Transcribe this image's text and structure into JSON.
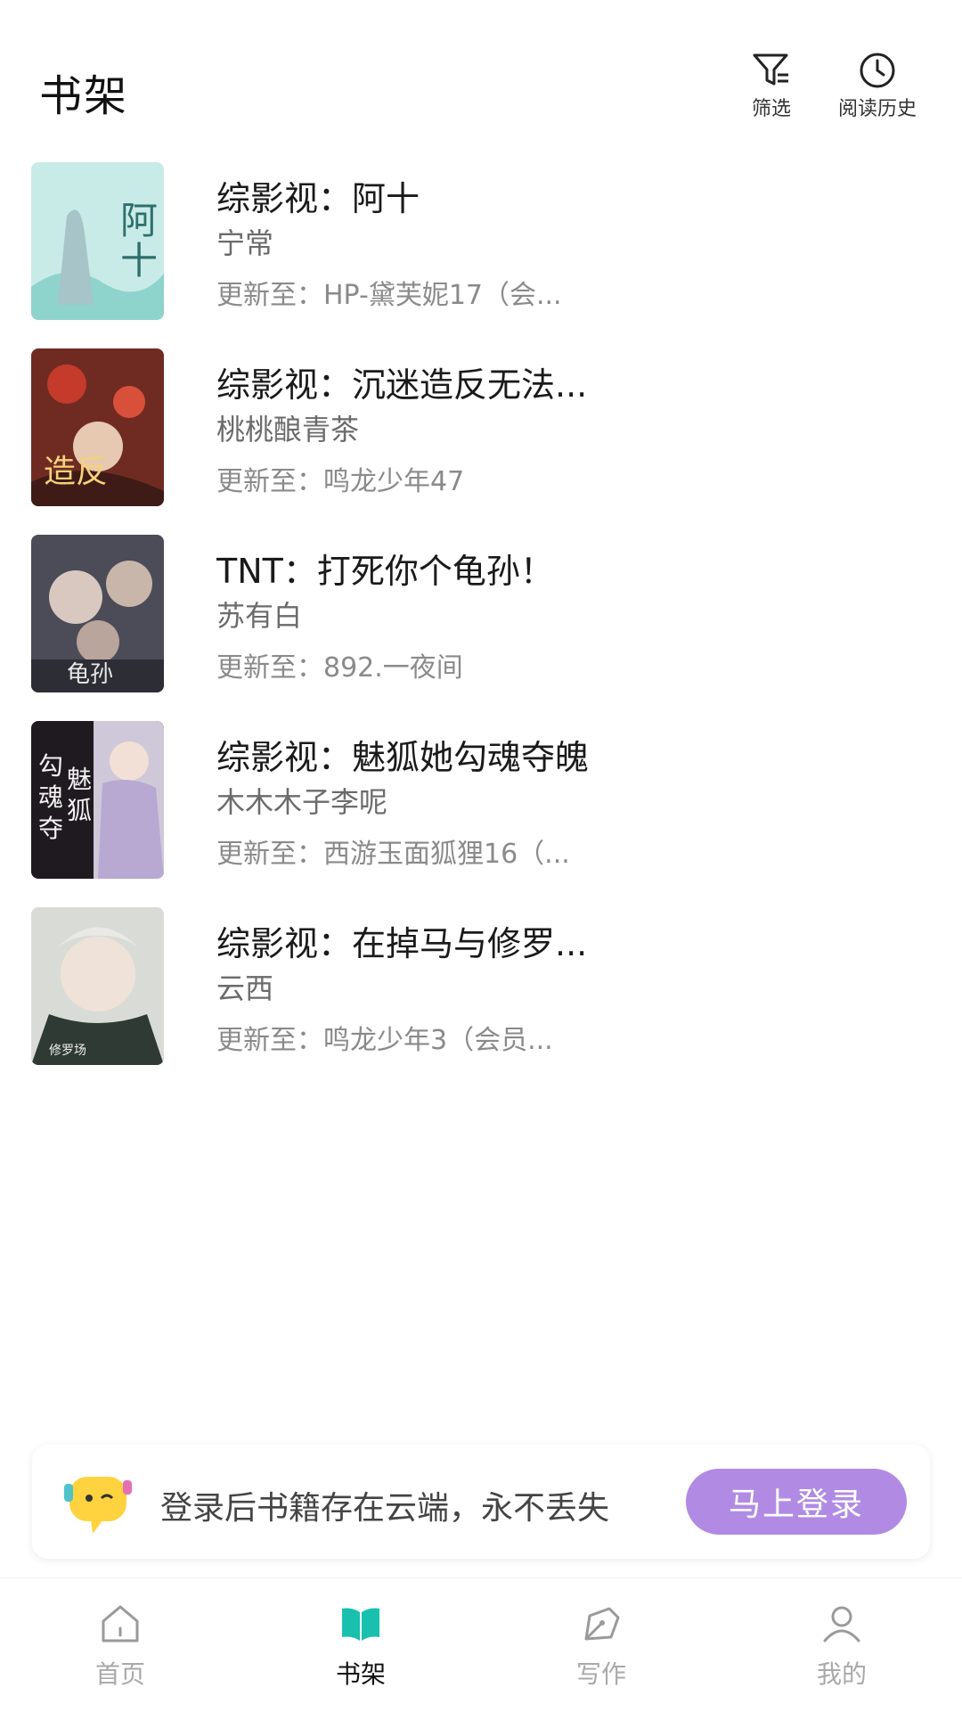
{
  "header": {
    "title": "书架",
    "filter_label": "筛选",
    "history_label": "阅读历史"
  },
  "books": [
    {
      "title": "综影视：阿十",
      "author": "宁常",
      "update": "更新至：HP-黛芙妮17（会..."
    },
    {
      "title": "综影视：沉迷造反无法...",
      "author": "桃桃酿青茶",
      "update": "更新至：鸣龙少年47"
    },
    {
      "title": "TNT：打死你个龟孙！",
      "author": "苏有白",
      "update": "更新至：892.一夜间"
    },
    {
      "title": "综影视：魅狐她勾魂夺魄",
      "author": "木木木子李呢",
      "update": "更新至：西游玉面狐狸16（..."
    },
    {
      "title": "综影视：在掉马与修罗...",
      "author": "云西",
      "update": "更新至：鸣龙少年3（会员..."
    }
  ],
  "login_banner": {
    "text": "登录后书籍存在云端，永不丢失",
    "button": "马上登录"
  },
  "tabs": [
    {
      "label": "首页",
      "icon": "home-icon",
      "active": false
    },
    {
      "label": "书架",
      "icon": "book-icon",
      "active": true
    },
    {
      "label": "写作",
      "icon": "pen-icon",
      "active": false
    },
    {
      "label": "我的",
      "icon": "user-icon",
      "active": false
    }
  ],
  "colors": {
    "accent_teal": "#19c0ad",
    "login_button": "#b18be3",
    "inactive_tab": "#a9a9a9"
  }
}
